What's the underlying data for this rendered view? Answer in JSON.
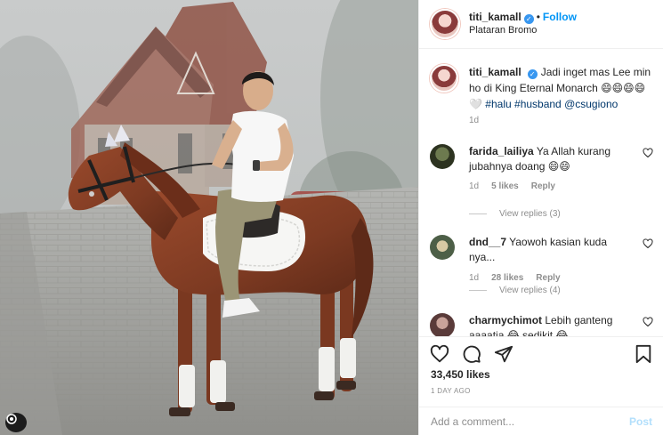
{
  "post": {
    "username": "titi_kamall",
    "follow_label": "Follow",
    "separator": "•",
    "location": "Plataran Bromo"
  },
  "caption": {
    "username": "titi_kamall",
    "text": "Jadi inget mas Lee min ho di King Eternal Monarch 😄😄😄😄 🤍",
    "hashtags": [
      "#halu",
      "#husband"
    ],
    "mention": "@csugiono",
    "time": "1d"
  },
  "comments": [
    {
      "username": "farida_lailiya",
      "text": "Ya Allah kurang jubahnya doang 😄😄",
      "time": "1d",
      "likes": "5 likes",
      "reply": "Reply",
      "view_replies": "View replies (3)"
    },
    {
      "username": "dnd__7",
      "text": "Yaowoh kasian kuda nya...",
      "time": "1d",
      "likes": "28 likes",
      "reply": "Reply",
      "view_replies": "View replies (4)"
    },
    {
      "username": "charmychimot",
      "text": "Lebih ganteng aaaatia 😂 sedikit 😂"
    }
  ],
  "actions": {
    "likes_count": "33,450 likes",
    "posted_time": "1 DAY AGO"
  },
  "add_comment": {
    "placeholder": "Add a comment...",
    "post_label": "Post"
  },
  "colors": {
    "accent": "#0095f6",
    "verified": "#3897f0",
    "hashtag": "#00376b",
    "muted": "#8e8e8e",
    "border": "#efefef"
  },
  "icons": [
    "verified-badge-icon",
    "heart-icon",
    "comment-icon",
    "share-icon",
    "bookmark-icon",
    "emoji-icon"
  ]
}
